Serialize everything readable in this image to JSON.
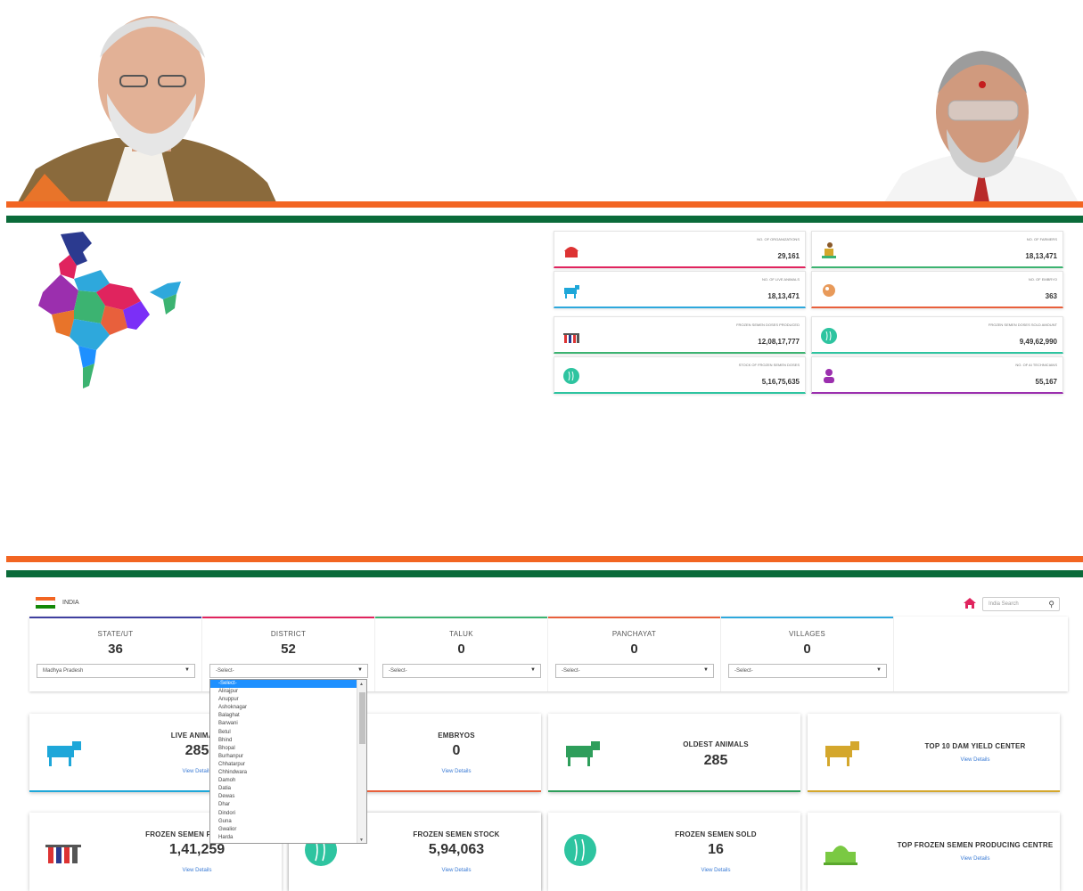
{
  "stats": [
    {
      "label": "NO. OF ORGANIZATIONS",
      "value": "29,161",
      "icon": "building-icon"
    },
    {
      "label": "NO. OF FARMERS",
      "value": "18,13,471",
      "icon": "farmer-icon"
    },
    {
      "label": "NO. OF LIVE ANIMALS",
      "value": "18,13,471",
      "icon": "cow-icon"
    },
    {
      "label": "NO. OF EMBRYO",
      "value": "363",
      "icon": "embryo-icon"
    },
    {
      "label": "FROZEN SEMEN DOSES PRODUCED",
      "value": "12,08,17,777",
      "icon": "test-tubes-icon"
    },
    {
      "label": "FROZEN SEMEN DOSES SOLD AMOUNT",
      "value": "9,49,62,990",
      "icon": "semen-icon"
    },
    {
      "label": "STOCK OF FROZEN SEMEN DOSES",
      "value": "5,16,75,635",
      "icon": "semen-stock-icon"
    },
    {
      "label": "NO. OF AI TECHNICIANS",
      "value": "55,167",
      "icon": "technician-icon"
    }
  ],
  "nav": {
    "breadcrumb": "INDIA",
    "search_placeholder": "India Search"
  },
  "levels": [
    {
      "title": "STATE/UT",
      "count": "36",
      "selected": "Madhya Pradesh",
      "color": "#3f3f9f"
    },
    {
      "title": "DISTRICT",
      "count": "52",
      "selected": "-Select-",
      "color": "#e0245e"
    },
    {
      "title": "TALUK",
      "count": "0",
      "selected": "-Select-",
      "color": "#3cb371"
    },
    {
      "title": "PANCHAYAT",
      "count": "0",
      "selected": "-Select-",
      "color": "#e8603c"
    },
    {
      "title": "VILLAGES",
      "count": "0",
      "selected": "-Select-",
      "color": "#2ea8dc"
    }
  ],
  "district_options": [
    "-Select-",
    "Alirajpur",
    "Anuppur",
    "Ashoknagar",
    "Balaghat",
    "Barwani",
    "Betul",
    "Bhind",
    "Bhopal",
    "Burhanpur",
    "Chhatarpur",
    "Chhindwara",
    "Damoh",
    "Datia",
    "Dewas",
    "Dhar",
    "Dindori",
    "Guna",
    "Gwalior",
    "Harda"
  ],
  "cards": [
    {
      "title": "LIVE ANIMALS",
      "value": "285",
      "link": "View Details",
      "color": "#1ea7d9",
      "icon": "cow-icon"
    },
    {
      "title": "EMBRYOS",
      "value": "0",
      "link": "View Details",
      "color": "#e8603c",
      "icon": "embryo-icon"
    },
    {
      "title": "OLDEST ANIMALS",
      "value": "285",
      "link": "",
      "color": "#2e9e5b",
      "icon": "cow-icon"
    },
    {
      "title": "TOP 10 DAM YIELD CENTER",
      "value": "",
      "link": "View Details",
      "color": "#d4a72c",
      "icon": "cow-icon"
    },
    {
      "title": "FROZEN SEMEN PRODUCED",
      "value": "1,41,259",
      "link": "View Details",
      "color": "#1ea7d9",
      "icon": "test-tubes-icon"
    },
    {
      "title": "",
      "value": "",
      "link": "",
      "color": "#2ec4a0",
      "icon": "semen-icon"
    },
    {
      "title": "FROZEN SEMEN STOCK",
      "value": "5,94,063",
      "link": "View Details",
      "color": "#2ec4a0",
      "icon": "semen-icon"
    },
    {
      "title": "FROZEN SEMEN SOLD",
      "value": "16",
      "link": "View Details",
      "color": "#2ec4a0",
      "icon": "semen-icon"
    },
    {
      "title": "TOP FROZEN SEMEN PRODUCING CENTRE",
      "value": "",
      "link": "View Details",
      "color": "#7ac943",
      "icon": "building-icon"
    }
  ],
  "colors": {
    "saffron": "#f26522",
    "green": "#0b6b3a"
  }
}
